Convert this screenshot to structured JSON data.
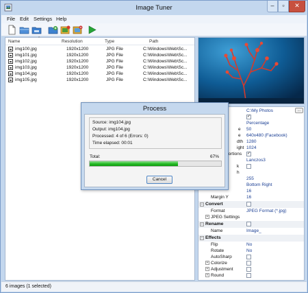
{
  "window": {
    "title": "Image Tuner"
  },
  "menu": [
    "File",
    "Edit",
    "Settings",
    "Help"
  ],
  "toolbar": {
    "buttons": [
      "new-icon",
      "open-icon",
      "save-icon",
      "add-images-icon",
      "add-folder-icon",
      "remove-icon",
      "start-icon"
    ]
  },
  "file_list": {
    "columns": [
      "Name",
      "Resolution",
      "Type",
      "Path"
    ],
    "rows": [
      {
        "name": "img100.jpg",
        "resolution": "1920x1200",
        "type": "JPG File",
        "path": "C:\\Windows\\Web\\Sc..."
      },
      {
        "name": "img101.jpg",
        "resolution": "1920x1200",
        "type": "JPG File",
        "path": "C:\\Windows\\Web\\Sc..."
      },
      {
        "name": "img102.jpg",
        "resolution": "1920x1200",
        "type": "JPG File",
        "path": "C:\\Windows\\Web\\Sc..."
      },
      {
        "name": "img103.jpg",
        "resolution": "1920x1200",
        "type": "JPG File",
        "path": "C:\\Windows\\Web\\Sc..."
      },
      {
        "name": "img104.jpg",
        "resolution": "1920x1200",
        "type": "JPG File",
        "path": "C:\\Windows\\Web\\Sc..."
      },
      {
        "name": "img105.jpg",
        "resolution": "1920x1200",
        "type": "JPG File",
        "path": "C:\\Windows\\Web\\Sc..."
      }
    ]
  },
  "properties": {
    "top_rows": [
      {
        "label": "",
        "value": "C:\\My Photos"
      },
      {
        "label": "",
        "checked": true
      },
      {
        "label": "",
        "value": "Percentage"
      },
      {
        "label": "e",
        "value": "50"
      },
      {
        "label": "e",
        "value": "640x480 (Facebook)"
      },
      {
        "label": "dth",
        "value": "1280"
      },
      {
        "label": "ight",
        "value": "1024"
      },
      {
        "label": "portions",
        "checked": true
      },
      {
        "label": "",
        "value": "Lanczos3"
      },
      {
        "label": "k",
        "checked": false
      },
      {
        "label": "h",
        "value": ""
      },
      {
        "label": "",
        "value": "255"
      },
      {
        "label": "",
        "value": "Bottom Right"
      },
      {
        "label": "",
        "value": "16"
      },
      {
        "label": "Margin Y",
        "value": "16"
      }
    ],
    "convert": {
      "title": "Convert",
      "format_label": "Format",
      "format_value": "JPEG Format (*.jpg)",
      "jpeg_settings": "JPEG Settings"
    },
    "rename": {
      "title": "Rename",
      "name_label": "Name",
      "name_value": "Image_"
    },
    "effects": {
      "title": "Effects",
      "flip_label": "Flip",
      "flip_value": "No",
      "rotate_label": "Rotate",
      "rotate_value": "No",
      "autosharp_label": "AutoSharp",
      "colorize_label": "Colorize",
      "adjustment_label": "Adjustment",
      "round_label": "Round"
    },
    "browse_label": "..."
  },
  "status": {
    "text": "6 images (1 selected)"
  },
  "dialog": {
    "title": "Process",
    "source": "Source: img104.jpg",
    "output": "Output: img104.jpg",
    "processed": "Processed: 4 of 6 (Errors: 0)",
    "elapsed": "Time elapsed: 00:01",
    "total_label": "Total:",
    "percent_text": "67%",
    "progress": 0.67,
    "cancel_label": "Cancel"
  },
  "colors": {
    "progress_green": "#23b923",
    "accent_blue": "#1b3f94",
    "close_red": "#c7503f"
  }
}
